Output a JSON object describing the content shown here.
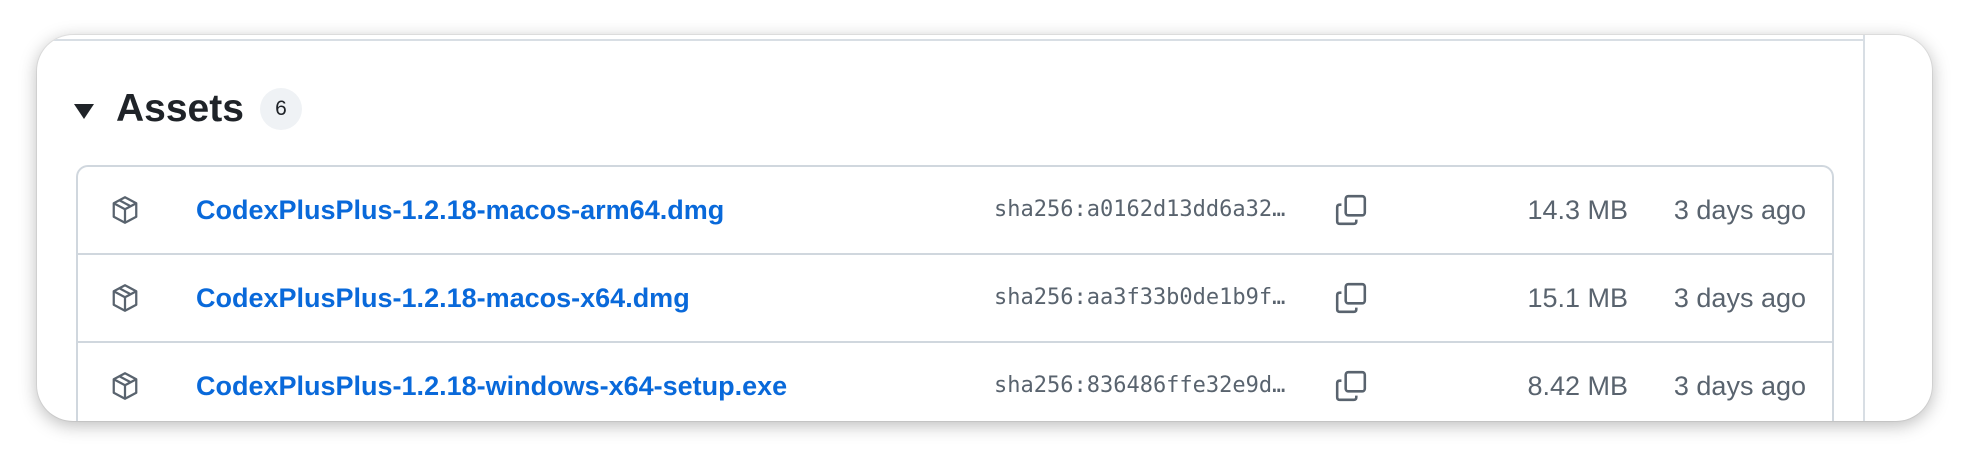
{
  "assets_section": {
    "title": "Assets",
    "count": "6",
    "toggle_icon": "triangle-down-icon"
  },
  "assets": [
    {
      "name": "CodexPlusPlus-1.2.18-macos-arm64.dmg",
      "sha": "sha256:a0162d13dd6a32…",
      "size": "14.3 MB",
      "date": "3 days ago",
      "icon": "package-icon"
    },
    {
      "name": "CodexPlusPlus-1.2.18-macos-x64.dmg",
      "sha": "sha256:aa3f33b0de1b9f…",
      "size": "15.1 MB",
      "date": "3 days ago",
      "icon": "package-icon"
    },
    {
      "name": "CodexPlusPlus-1.2.18-windows-x64-setup.exe",
      "sha": "sha256:836486ffe32e9d…",
      "size": "8.42 MB",
      "date": "3 days ago",
      "icon": "package-icon"
    }
  ],
  "colors": {
    "link": "#0969da",
    "muted_text": "#59636e",
    "border": "#d0d7de",
    "badge_bg": "#eff2f5"
  }
}
